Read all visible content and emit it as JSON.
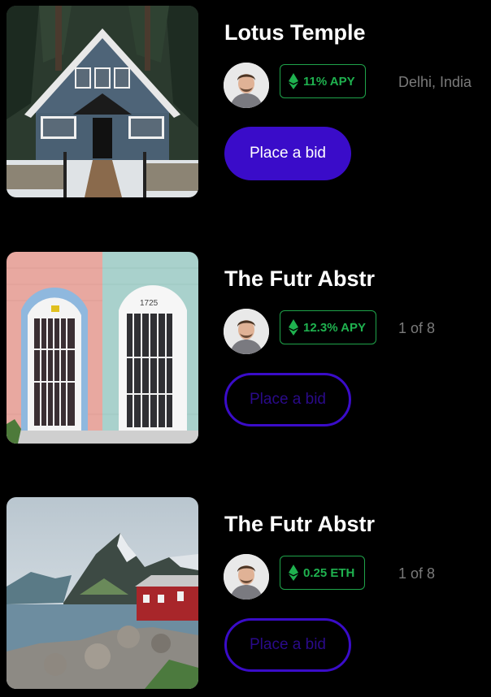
{
  "listings": [
    {
      "title": "Lotus Temple",
      "badge_icon": "ethereum-icon",
      "badge": "11% APY",
      "meta": "Delhi, India",
      "button": "Place a bid",
      "button_style": "filled",
      "image": "house-photo"
    },
    {
      "title": "The Futr Abstr",
      "badge_icon": "ethereum-icon",
      "badge": "12.3% APY",
      "meta": "1 of 8",
      "button": "Place a bid",
      "button_style": "outline",
      "image": "doors-photo"
    },
    {
      "title": "The Futr Abstr",
      "badge_icon": "ethereum-icon",
      "badge": "0.25 ETH",
      "meta": "1 of 8",
      "button": "Place a bid",
      "button_style": "outline",
      "image": "mountain-lake-photo"
    }
  ],
  "colors": {
    "background": "#000000",
    "accent": "#3a0cc9",
    "badge_green": "#1fb24f",
    "meta_gray": "#7a7a7a"
  }
}
